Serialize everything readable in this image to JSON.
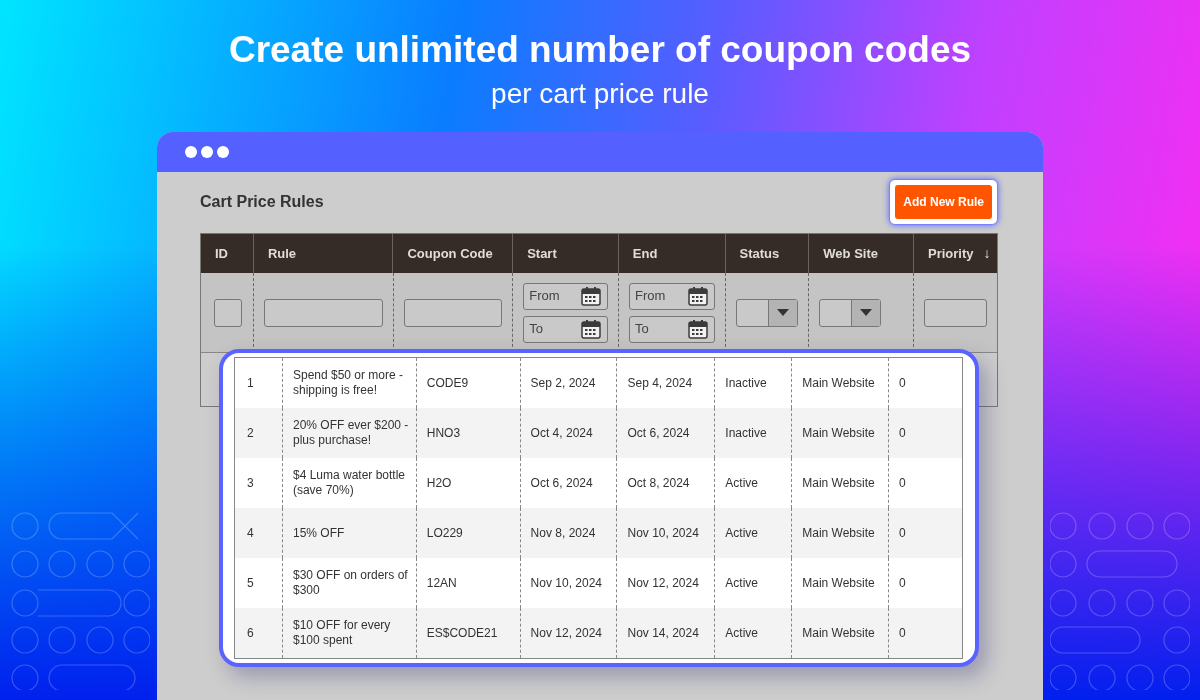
{
  "headline": "Create unlimited number of coupon codes",
  "subheadline": "per cart price rule",
  "page_title": "Cart Price Rules",
  "add_button": "Add New Rule",
  "table": {
    "columns": [
      {
        "label": "ID"
      },
      {
        "label": "Rule"
      },
      {
        "label": "Coupon Code"
      },
      {
        "label": "Start"
      },
      {
        "label": "End"
      },
      {
        "label": "Status"
      },
      {
        "label": "Web Site"
      },
      {
        "label": "Priority",
        "sort": "↓"
      }
    ],
    "filters": [
      {
        "kind": "box"
      },
      {
        "kind": "text"
      },
      {
        "kind": "text"
      },
      {
        "kind": "date-range",
        "from": "From",
        "to": "To"
      },
      {
        "kind": "date-range",
        "from": "From",
        "to": "To"
      },
      {
        "kind": "select"
      },
      {
        "kind": "select"
      },
      {
        "kind": "text"
      }
    ]
  },
  "highlight_rows": [
    {
      "id": "1",
      "rule": "Spend $50 or more -shipping is free!",
      "code": "CODE9",
      "start": "Sep 2, 2024",
      "end": "Sep 4, 2024",
      "status": "Inactive",
      "website": "Main Website",
      "priority": "0"
    },
    {
      "id": "2",
      "rule": "20% OFF ever $200 -plus purchase!",
      "code": "HNO3",
      "start": "Oct 4, 2024",
      "end": "Oct 6, 2024",
      "status": "Inactive",
      "website": "Main Website",
      "priority": "0"
    },
    {
      "id": "3",
      "rule": "$4 Luma water bottle (save 70%)",
      "code": "H2O",
      "start": "Oct 6, 2024",
      "end": "Oct 8, 2024",
      "status": "Active",
      "website": "Main Website",
      "priority": "0"
    },
    {
      "id": "4",
      "rule": "15% OFF",
      "code": "LO229",
      "start": "Nov 8, 2024",
      "end": "Nov 10, 2024",
      "status": "Active",
      "website": "Main Website",
      "priority": "0"
    },
    {
      "id": "5",
      "rule": "$30 OFF on orders of $300",
      "code": "12AN",
      "start": "Nov 10, 2024",
      "end": "Nov 12, 2024",
      "status": "Active",
      "website": "Main Website",
      "priority": "0"
    },
    {
      "id": "6",
      "rule": "$10 OFF for every $100 spent",
      "code": "ES$CODE21",
      "start": "Nov 12, 2024",
      "end": "Nov 14, 2024",
      "status": "Active",
      "website": "Main Website",
      "priority": "0"
    }
  ]
}
